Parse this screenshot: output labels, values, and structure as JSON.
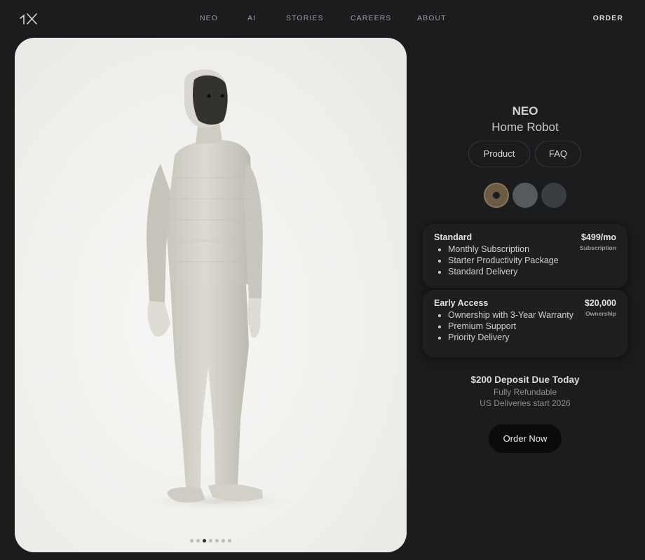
{
  "header": {
    "logo_alt": "1X",
    "nav": [
      {
        "label": "NEO"
      },
      {
        "label": "AI"
      },
      {
        "label": "STORIES"
      },
      {
        "label": "CAREERS"
      },
      {
        "label": "ABOUT"
      }
    ],
    "order_label": "ORDER"
  },
  "gallery": {
    "image_name": "robot-product-image",
    "slides": 7,
    "active_slide": 3
  },
  "product": {
    "name": "NEO",
    "tagline": "Home Robot",
    "tabs": [
      {
        "label": "Product"
      },
      {
        "label": "FAQ"
      }
    ],
    "colors": [
      "#6b5a44",
      "#56595e",
      "#3a3d41"
    ],
    "selected_color": 0
  },
  "plans": [
    {
      "name": "Standard",
      "price": "$499/mo",
      "kind": "Subscription",
      "features": [
        "Monthly Subscription",
        "Starter Productivity Package",
        "Standard Delivery"
      ]
    },
    {
      "name": "Early Access",
      "price": "$20,000",
      "kind": "Ownership",
      "features": [
        "Ownership with 3-Year Warranty",
        "Premium Support",
        "Priority Delivery"
      ]
    }
  ],
  "checkout": {
    "deposit": "$200 Deposit Due Today",
    "refund_note": "Fully Refundable",
    "delivery_note": "US Deliveries start 2026",
    "button_label": "Order Now"
  }
}
